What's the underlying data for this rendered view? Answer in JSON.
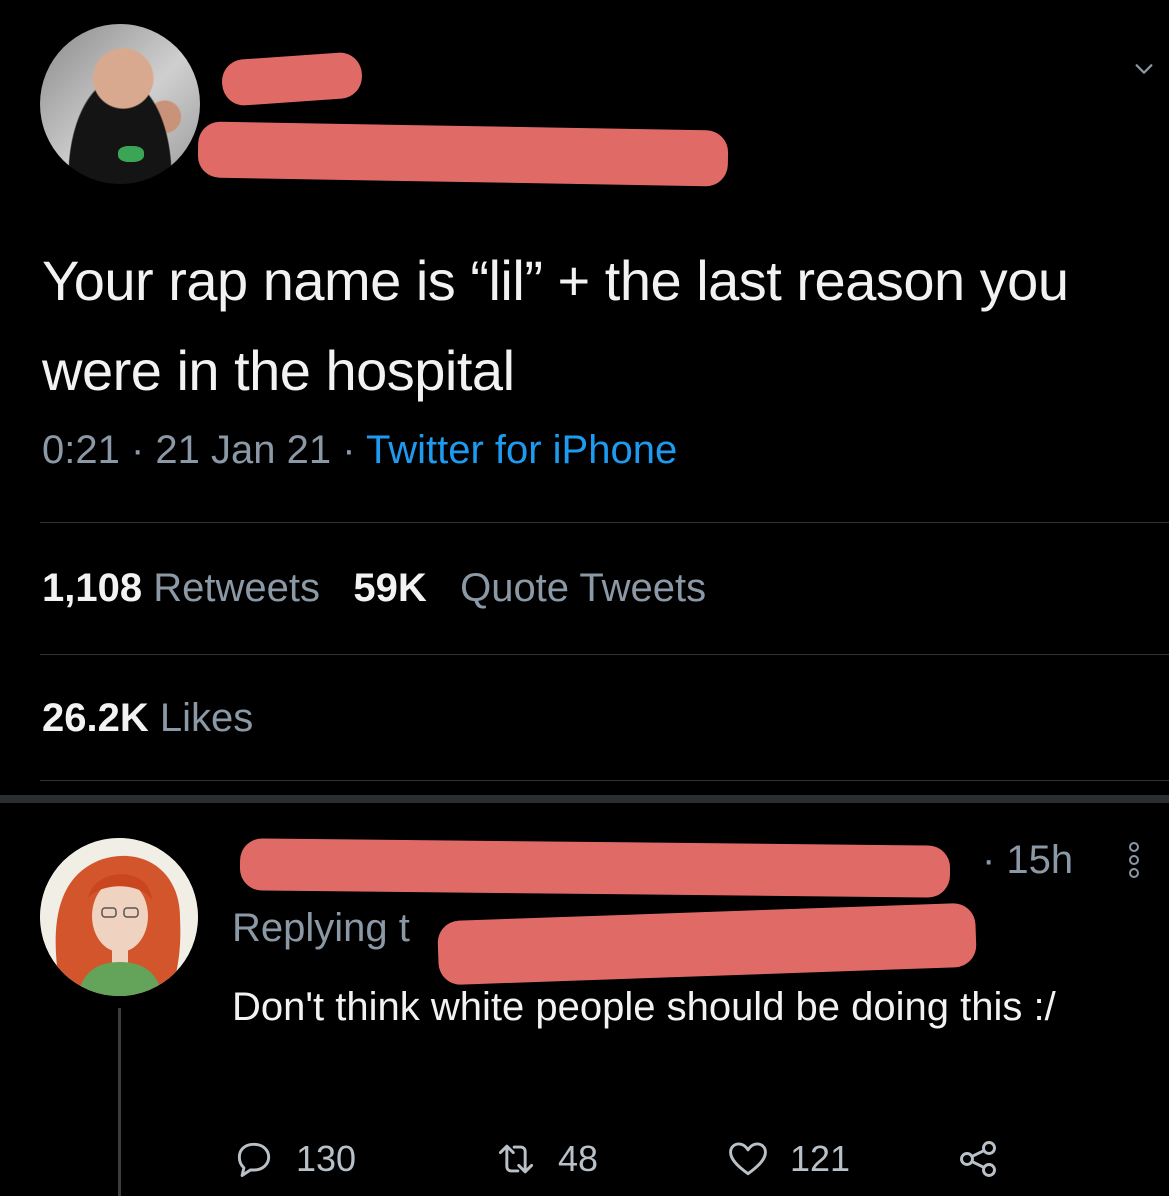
{
  "main_tweet": {
    "text": "Your rap name is “lil” + the last reason you were in the hospital",
    "time": "0:21",
    "date": "21 Jan 21",
    "source": "Twitter for iPhone",
    "retweets_count": "1,108",
    "retweets_label": "Retweets",
    "quote_count": "59K",
    "quote_label": "Quote Tweets",
    "likes_count": "26.2K",
    "likes_label": "Likes"
  },
  "reply": {
    "time": "· 15h",
    "replying_label": "Replying t",
    "text": "Don't think white people should be doing this :/",
    "reply_count": "130",
    "retweet_count": "48",
    "like_count": "121"
  },
  "icons": [
    "chevron-down-icon",
    "more-dots-icon",
    "reply-icon",
    "retweet-icon",
    "heart-icon",
    "share-icon"
  ],
  "colors": {
    "background": "#000000",
    "link": "#1d9bf0",
    "redaction": "#e06b66",
    "muted": "#8b98a5"
  }
}
